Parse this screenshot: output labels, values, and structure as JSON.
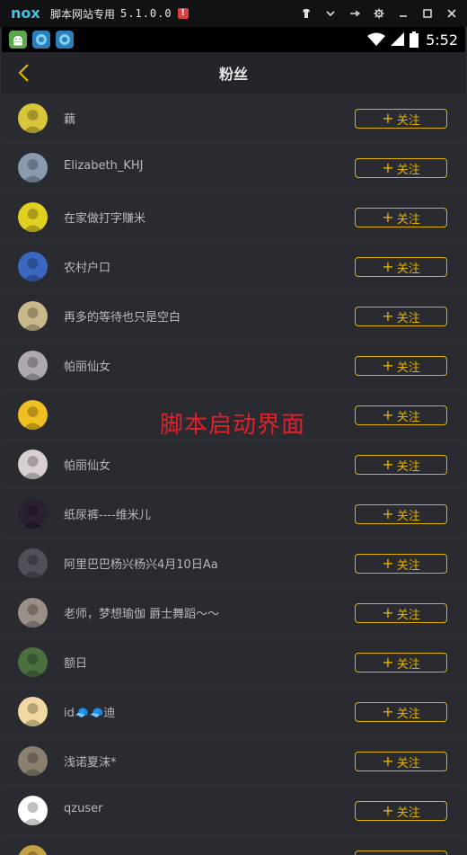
{
  "emulator": {
    "title": "脚本网站专用",
    "version": "5.1.0.0",
    "alert_badge": "!",
    "logo_icon": "nox-logo",
    "controls": [
      "shirt-icon",
      "chevron-down-icon",
      "pin-icon",
      "gear-icon",
      "minimize-icon",
      "maximize-icon",
      "close-icon"
    ]
  },
  "statusbar": {
    "apps": [
      {
        "icon": "android-robot-icon",
        "color": "#5aa84a"
      },
      {
        "icon": "app-blue-icon",
        "color": "#3aa0d8"
      },
      {
        "icon": "app-blue-icon-2",
        "color": "#3aa0d8"
      }
    ],
    "time": "5:52"
  },
  "header": {
    "title": "粉丝",
    "back_icon": "chevron-left-icon",
    "accent": "#e3b200"
  },
  "follow_label": "关注",
  "watermark": "脚本启动界面",
  "followers": [
    {
      "name": "藕",
      "avatar_color": "#d8c63a"
    },
    {
      "name": "Elizabeth_KHJ",
      "avatar_color": "#8a9bb0"
    },
    {
      "name": "在家做打字赚米",
      "avatar_color": "#e0d020"
    },
    {
      "name": "农村户口",
      "avatar_color": "#3a68c0"
    },
    {
      "name": "再多的等待也只是空白",
      "avatar_color": "#c9b98a"
    },
    {
      "name": "帕丽仙女",
      "avatar_color": "#b0a8b0"
    },
    {
      "name": "",
      "avatar_color": "#f0c020"
    },
    {
      "name": "帕丽仙女",
      "avatar_color": "#d8d0d0"
    },
    {
      "name": "纸尿裤----维米儿",
      "avatar_color": "#2a2030"
    },
    {
      "name": "阿里巴巴杨兴杨兴4月10日Aa",
      "avatar_color": "#505058"
    },
    {
      "name": "老师，梦想瑜伽 爵士舞蹈～～",
      "avatar_color": "#9a9088"
    },
    {
      "name": "额日",
      "avatar_color": "#4a7040"
    },
    {
      "name": "id🧢🧢迪",
      "avatar_color": "#f0d8a0"
    },
    {
      "name": "浅诺夏沫*",
      "avatar_color": "#8a8070"
    },
    {
      "name": "qzuser",
      "avatar_color": "#ffffff"
    },
    {
      "name": "",
      "avatar_color": "#c0a040"
    }
  ]
}
